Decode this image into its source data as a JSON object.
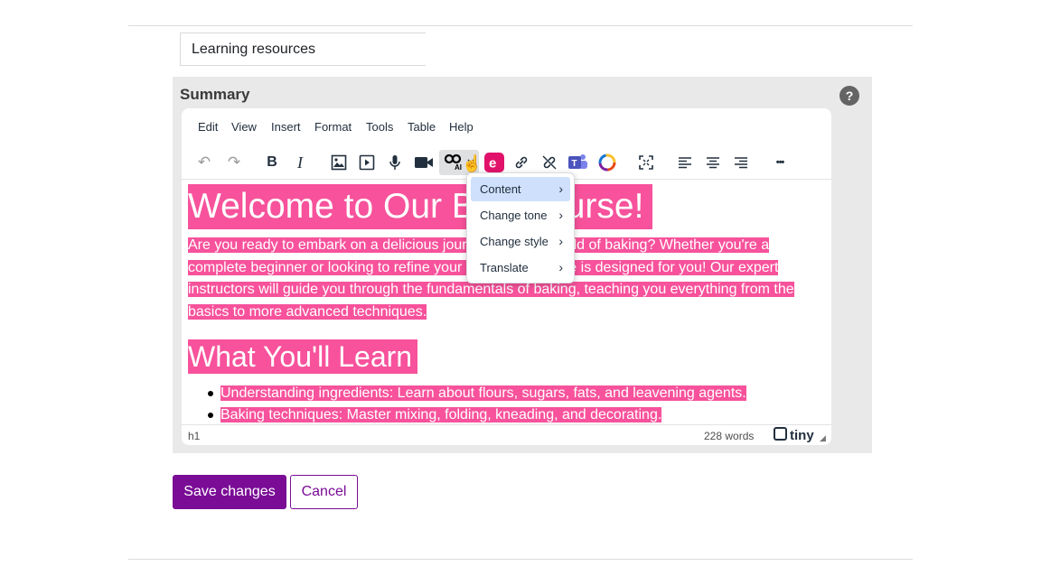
{
  "form": {
    "title_value": "Learning resources",
    "summary_label": "Summary",
    "help_icon": "?"
  },
  "menubar": [
    "Edit",
    "View",
    "Insert",
    "Format",
    "Tools",
    "Table",
    "Help"
  ],
  "toolbar": {
    "undo": "↶",
    "redo": "↷",
    "bold": "B",
    "italic": "I",
    "more": "•••"
  },
  "content": {
    "h1": "Welcome to Our B",
    "h1_tail": "Course!",
    "paragraph_parts": [
      "Are you ready to embark on a delicious jour",
      "ld of baking? Whether you're a complete beginner or looking to refine your",
      "e is designed for you! Our expert instructors will guide you through the fundamentals of baking, teaching you everything from the basics to more advanced techniques."
    ],
    "h2": "What You'll Learn",
    "list": [
      "Understanding ingredients: Learn about flours, sugars, fats, and leavening agents.",
      "Baking techniques: Master mixing, folding, kneading, and decorating."
    ]
  },
  "status": {
    "path": "h1",
    "words": "228 words",
    "brand": "tiny"
  },
  "dropdown": {
    "items": [
      {
        "label": "Content",
        "active": true
      },
      {
        "label": "Change tone",
        "active": false
      },
      {
        "label": "Change style",
        "active": false
      },
      {
        "label": "Translate",
        "active": false
      }
    ]
  },
  "buttons": {
    "save": "Save changes",
    "cancel": "Cancel"
  },
  "colors": {
    "highlight": "#f7529b",
    "primary": "#7a0c96"
  }
}
